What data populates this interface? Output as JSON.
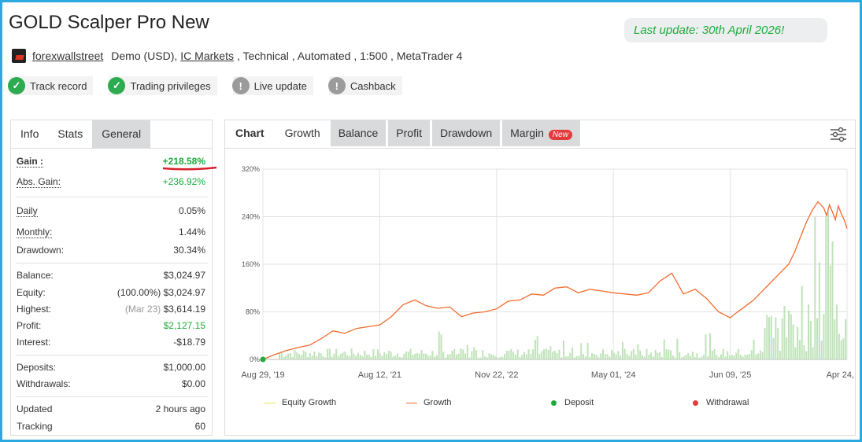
{
  "header": {
    "title": "GOLD Scalper Pro New",
    "last_update": "Last update: 30th April 2026!"
  },
  "meta": {
    "author": "forexwallstreet",
    "account": "Demo (USD),",
    "broker": "IC Markets",
    "details": ", Technical , Automated , 1:500 , MetaTrader 4"
  },
  "badges": [
    {
      "label": "Track record",
      "icon": "check-icon",
      "status": "ok"
    },
    {
      "label": "Trading privileges",
      "icon": "check-icon",
      "status": "ok"
    },
    {
      "label": "Live update",
      "icon": "exclamation-icon",
      "status": "warn"
    },
    {
      "label": "Cashback",
      "icon": "exclamation-icon",
      "status": "warn"
    }
  ],
  "left_panel": {
    "tabs": [
      "Info",
      "Stats",
      "General"
    ],
    "stats": {
      "gain_label": "Gain :",
      "gain": "+218.58%",
      "abs_gain_label": "Abs. Gain:",
      "abs_gain": "+236.92%",
      "daily_label": "Daily",
      "daily": "0.05%",
      "monthly_label": "Monthly:",
      "monthly": "1.44%",
      "drawdown_label": "Drawdown:",
      "drawdown": "30.34%",
      "balance_label": "Balance:",
      "balance": "$3,024.97",
      "equity_label": "Equity:",
      "equity_pct": "(100.00%)",
      "equity": "$3,024.97",
      "highest_label": "Highest:",
      "highest_date": "(Mar 23)",
      "highest": "$3,614.19",
      "profit_label": "Profit:",
      "profit": "$2,127.15",
      "interest_label": "Interest:",
      "interest": "-$18.79",
      "deposits_label": "Deposits:",
      "deposits": "$1,000.00",
      "withdrawals_label": "Withdrawals:",
      "withdrawals": "$0.00",
      "updated_label": "Updated",
      "updated": "2 hours ago",
      "tracking_label": "Tracking",
      "tracking": "60"
    }
  },
  "right_panel": {
    "tabs": [
      "Chart",
      "Growth",
      "Balance",
      "Profit",
      "Drawdown",
      "Margin"
    ],
    "new_badge": "New",
    "settings_icon": "sliders-icon"
  },
  "colors": {
    "growth": "#f26b2c",
    "volume": "#bfe3b8",
    "equity": "#e6e64d",
    "deposit": "#1eab3b",
    "withdrawal": "#e23b3b",
    "accent_green": "#1eab3b"
  },
  "chart_data": {
    "type": "line",
    "y_ticks": [
      "0%",
      "80%",
      "160%",
      "240%",
      "320%"
    ],
    "ylim": [
      0,
      320
    ],
    "x_ticks": [
      "Aug 29, '19",
      "Aug 12, '21",
      "Nov 22, '22",
      "May 01, '24",
      "Jun 09, '25",
      "Apr 24, '26"
    ],
    "legend": [
      "Equity Growth",
      "Growth",
      "Deposit",
      "Withdrawal"
    ],
    "grid": true,
    "series": [
      {
        "name": "Growth",
        "x": [
          0,
          0.02,
          0.04,
          0.06,
          0.08,
          0.1,
          0.12,
          0.14,
          0.16,
          0.18,
          0.2,
          0.22,
          0.24,
          0.26,
          0.28,
          0.3,
          0.32,
          0.34,
          0.36,
          0.38,
          0.4,
          0.42,
          0.44,
          0.46,
          0.48,
          0.5,
          0.52,
          0.54,
          0.56,
          0.58,
          0.6,
          0.62,
          0.64,
          0.66,
          0.68,
          0.7,
          0.72,
          0.74,
          0.76,
          0.78,
          0.8,
          0.81,
          0.82,
          0.84,
          0.86,
          0.88,
          0.9,
          0.91,
          0.92,
          0.93,
          0.94,
          0.95,
          0.96,
          0.965,
          0.97,
          0.975,
          0.98,
          0.985,
          0.99,
          0.995,
          1.0
        ],
        "values": [
          0,
          8,
          15,
          20,
          24,
          35,
          48,
          44,
          52,
          55,
          58,
          72,
          92,
          100,
          90,
          86,
          88,
          72,
          78,
          80,
          85,
          98,
          100,
          110,
          108,
          120,
          122,
          112,
          118,
          115,
          112,
          110,
          108,
          112,
          132,
          145,
          110,
          118,
          102,
          80,
          70,
          78,
          85,
          100,
          120,
          140,
          160,
          180,
          205,
          230,
          250,
          265,
          255,
          242,
          260,
          248,
          235,
          258,
          245,
          235,
          220
        ]
      }
    ],
    "deposit_points": [
      {
        "x": 0,
        "y": 0
      }
    ]
  }
}
